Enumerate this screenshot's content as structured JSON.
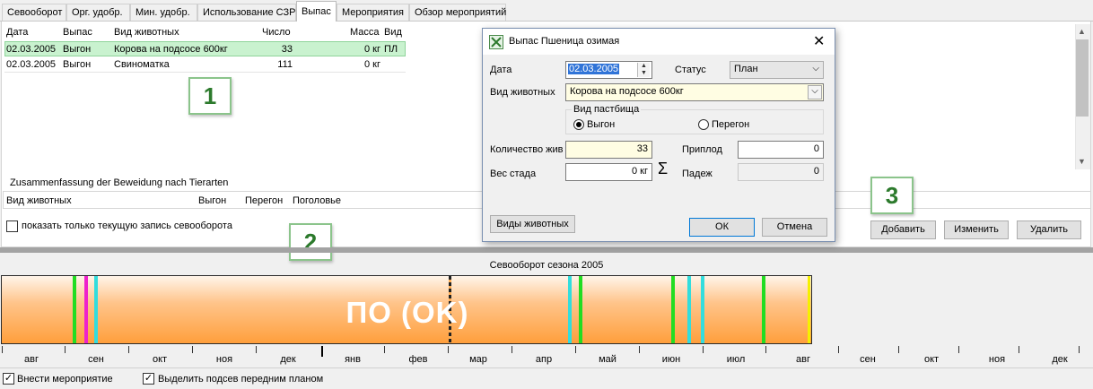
{
  "tabs": [
    "Севооборот",
    "Орг. удобр.",
    "Мин. удобр.",
    "Использование СЗР",
    "Выпас",
    "Мероприятия",
    "Обзор мероприятий"
  ],
  "grid": {
    "headers": [
      "Дата",
      "Выпас",
      "Вид животных",
      "Число",
      "Масса",
      "Вид"
    ],
    "rows": [
      {
        "date": "02.03.2005",
        "type": "Выгон",
        "animal": "Корова на подсосе 600кг",
        "count": "33",
        "mass": "0 кг",
        "kind": "ПЛ"
      },
      {
        "date": "02.03.2005",
        "type": "Выгон",
        "animal": "Свиноматка",
        "count": "111",
        "mass": "0 кг",
        "kind": ""
      }
    ]
  },
  "summary": {
    "label": "Zusammenfassung der Beweidung nach Tierarten",
    "headers": [
      "Вид животных",
      "Выгон",
      "Перегон",
      "Поголовье"
    ]
  },
  "show_current_label": "показать только текущую запись севооборота",
  "buttons": {
    "add": "Добавить",
    "edit": "Изменить",
    "delete": "Удалить"
  },
  "callouts": [
    "1",
    "2",
    "3"
  ],
  "season": {
    "label": "Севооборот сезона 2005",
    "bar_text": "ПО (OK)",
    "months": [
      "авг",
      "сен",
      "окт",
      "ноя",
      "дек",
      "янв",
      "фев",
      "мар",
      "апр",
      "май",
      "июн",
      "июл",
      "авг",
      "сен",
      "окт",
      "ноя",
      "дек"
    ]
  },
  "bottom": {
    "enter_event": "Внести мероприятие",
    "highlight": "Выделить подсев передним планом"
  },
  "dialog": {
    "title": "Выпас  Пшеница озимая",
    "date_label": "Дата",
    "date_value": "02.03.2005",
    "status_label": "Статус",
    "status_value": "План",
    "animal_label": "Вид животных",
    "animal_value": "Корова на подсосе 600кг",
    "pasture_group": "Вид пастбища",
    "radio_vygon": "Выгон",
    "radio_peregon": "Перегон",
    "qty_label": "Количество жив",
    "qty_value": "33",
    "offspring_label": "Приплод",
    "offspring_value": "0",
    "weight_label": "Вес стада",
    "weight_value": "0 кг",
    "sigma": "Σ",
    "loss_label": "Падеж",
    "loss_value": "0",
    "animals_button": "Виды животных",
    "ok": "ОК",
    "cancel": "Отмена"
  },
  "colors": {
    "green": "#22dd22",
    "magenta": "#ee22cc",
    "cyan": "#33dddd",
    "yellow": "#f5f000",
    "highlight": "#c9f2cf"
  }
}
